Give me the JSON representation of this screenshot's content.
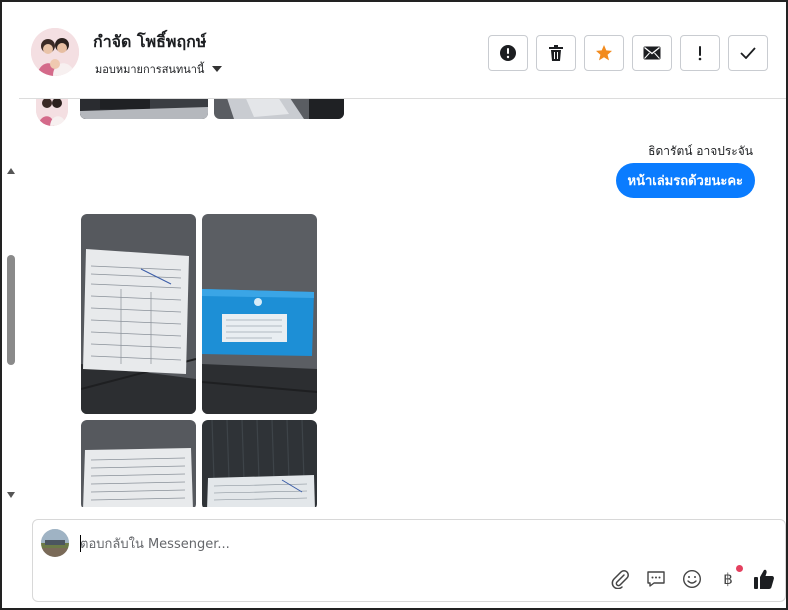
{
  "header": {
    "contact_name": "กำจัด โพธิ์พฤกษ์",
    "assign_label": "มอบหมายการสนทนานี้",
    "actions": [
      {
        "name": "report-spam-button",
        "icon": "exclamation-circle-icon"
      },
      {
        "name": "delete-button",
        "icon": "trash-icon"
      },
      {
        "name": "star-button",
        "icon": "star-icon"
      },
      {
        "name": "mark-unread-button",
        "icon": "envelope-icon"
      },
      {
        "name": "follow-up-button",
        "icon": "exclamation-icon"
      },
      {
        "name": "mark-done-button",
        "icon": "check-icon"
      }
    ]
  },
  "conversation": {
    "outgoing_sender": "ธิดารัตน์ อาจประจัน",
    "outgoing_message": "หน้าเล่มรถด้วยนะคะ"
  },
  "composer": {
    "placeholder": "ตอบกลับใน Messenger..."
  },
  "colors": {
    "accent": "#0a7cff",
    "star": "#f28b1e",
    "notification_dot": "#e4405f"
  }
}
